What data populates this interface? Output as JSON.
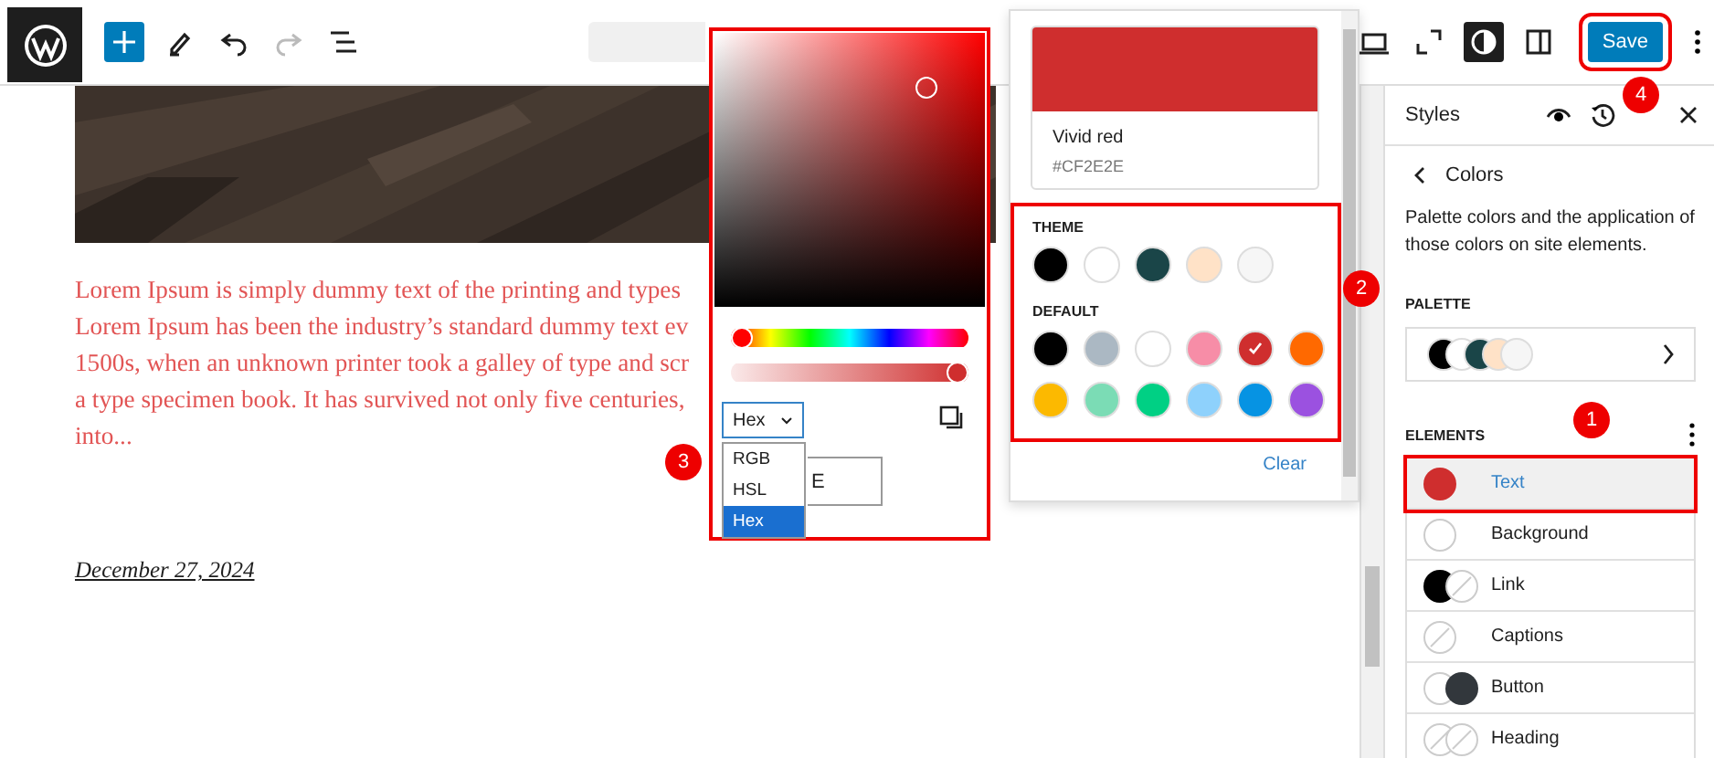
{
  "toolbar": {
    "tools": [
      {
        "kind": "inserter",
        "disabled": false
      },
      {
        "kind": "pen",
        "disabled": false
      },
      {
        "kind": "undo",
        "disabled": false
      },
      {
        "kind": "redo",
        "disabled": true
      },
      {
        "kind": "list-view",
        "disabled": false
      }
    ]
  },
  "header_actions": {
    "tools": [
      {
        "kind": "preview",
        "on": false
      },
      {
        "kind": "fullscreen",
        "on": false
      },
      {
        "kind": "styles",
        "on": true
      },
      {
        "kind": "settings",
        "on": false
      }
    ],
    "save_button": "Save"
  },
  "post": {
    "paragraph_lines": [
      "Lorem Ipsum is simply dummy text of the printing and types",
      "Lorem Ipsum has been the industry’s standard dummy text ev",
      "1500s, when an unknown printer took a galley of type and scr",
      "a type specimen book. It has survived not only five centuries,",
      "into..."
    ],
    "date": "December 27, 2024"
  },
  "color_picker": {
    "hue_slider": {
      "level": 0
    },
    "alpha_slider": {
      "level": 1
    },
    "format_select": {
      "value": "Hex"
    },
    "format_options": [
      {
        "label": "RGB",
        "selected": false
      },
      {
        "label": "HSL",
        "selected": false
      },
      {
        "label": "Hex",
        "selected": true
      }
    ],
    "hex_field": {
      "value": "E"
    }
  },
  "palette_popover": {
    "preview": {
      "color": "#cf2e2e",
      "name": "Vivid red",
      "hex": "#CF2E2E"
    },
    "theme": {
      "label": "THEME",
      "swatches": [
        {
          "color": "#000000",
          "selected": false
        },
        {
          "color": "#ffffff",
          "selected": false
        },
        {
          "color": "#1a4548",
          "selected": false
        },
        {
          "color": "#ffe2c7",
          "selected": false
        },
        {
          "color": "#f6f6f6",
          "selected": false
        }
      ]
    },
    "default": {
      "label": "DEFAULT",
      "swatches": [
        {
          "color": "#000000",
          "selected": false
        },
        {
          "color": "#abb8c3",
          "selected": false
        },
        {
          "color": "#ffffff",
          "selected": false
        },
        {
          "color": "#f78da7",
          "selected": false
        },
        {
          "color": "#cf2e2e",
          "selected": true
        },
        {
          "color": "#ff6900",
          "selected": false
        },
        {
          "color": "#fcb900",
          "selected": false
        },
        {
          "color": "#7bdcb5",
          "selected": false
        },
        {
          "color": "#00d084",
          "selected": false
        },
        {
          "color": "#8ed1fc",
          "selected": false
        },
        {
          "color": "#0693e3",
          "selected": false
        },
        {
          "color": "#9b51e0",
          "selected": false
        }
      ]
    },
    "clear_button": "Clear"
  },
  "sidebar": {
    "title": "Styles",
    "back_title": "Colors",
    "description": "Palette colors and the application of those colors on site elements.",
    "palette_label": "PALETTE",
    "palette_colors": [
      {
        "color": "#000000"
      },
      {
        "color": "#ffffff"
      },
      {
        "color": "#1a4548"
      },
      {
        "color": "#ffe2c7"
      },
      {
        "color": "#f6f6f6"
      }
    ],
    "elements_label": "ELEMENTS",
    "elements": [
      {
        "label": "Text",
        "kind": "filled",
        "color": "#cf2e2e",
        "selected": true
      },
      {
        "label": "Background",
        "kind": "blank",
        "selected": false
      },
      {
        "label": "Link",
        "kind": "link",
        "selected": false
      },
      {
        "label": "Captions",
        "kind": "unset",
        "selected": false
      },
      {
        "label": "Button",
        "kind": "button",
        "selected": false
      },
      {
        "label": "Heading",
        "kind": "heading",
        "selected": false
      }
    ]
  },
  "annotations": [
    {
      "label": "1"
    },
    {
      "label": "2"
    },
    {
      "label": "3"
    },
    {
      "label": "4"
    }
  ]
}
